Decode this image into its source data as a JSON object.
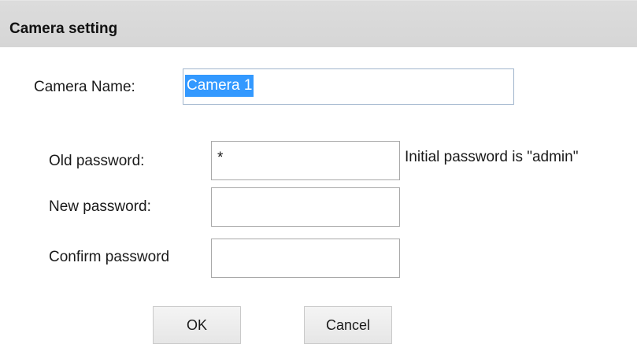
{
  "dialog": {
    "title": "Camera setting"
  },
  "camera": {
    "name_label": "Camera Name:",
    "name_value": "Camera 1"
  },
  "passwords": {
    "old_label": "Old password:",
    "old_value": "*",
    "old_hint": "Initial password is \"admin\"",
    "new_label": "New password:",
    "new_value": "",
    "confirm_label": "Confirm password",
    "confirm_value": ""
  },
  "buttons": {
    "ok_label": "OK",
    "cancel_label": "Cancel"
  },
  "colors": {
    "title_bar": "#d6d6d6",
    "selection": "#3399ff"
  }
}
